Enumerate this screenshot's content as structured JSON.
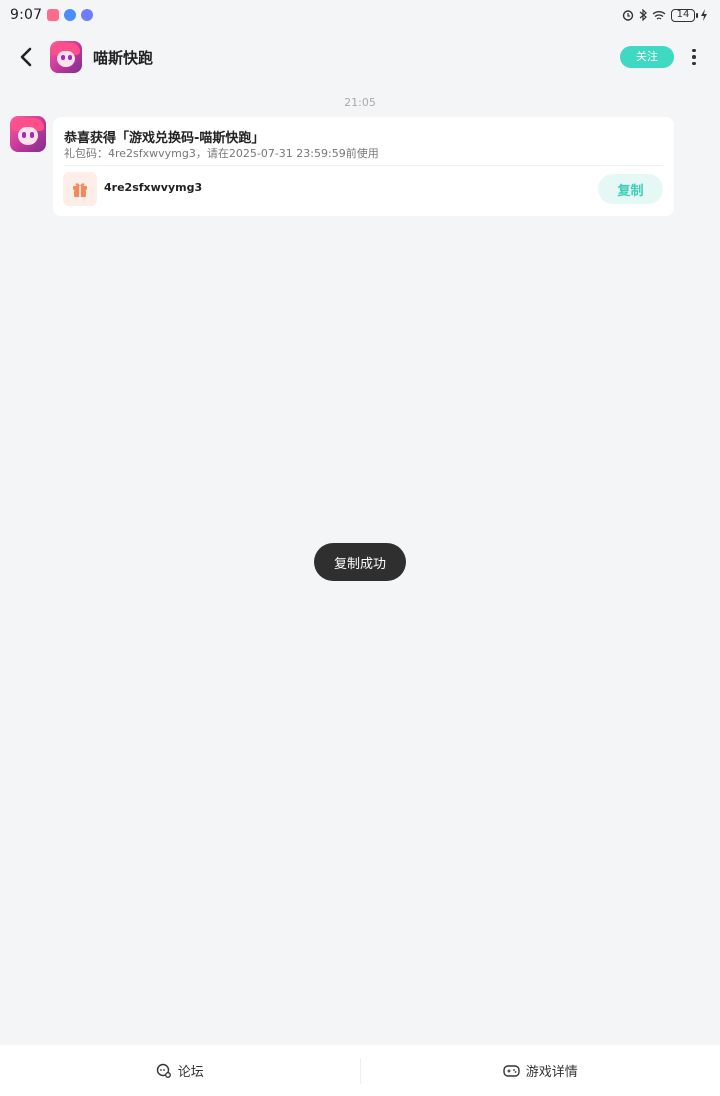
{
  "status_bar": {
    "time": "9:07",
    "battery": "14",
    "left_icons": [
      "app-notification-icon",
      "browser-icon",
      "music-icon"
    ],
    "right_icons": [
      "alarm-icon",
      "bluetooth-icon",
      "wifi-icon",
      "battery-icon",
      "charging-icon"
    ]
  },
  "header": {
    "app_name": "喵斯快跑",
    "follow_label": "关注",
    "back_icon": "chevron-left-icon",
    "more_icon": "more-vertical-icon"
  },
  "conversation": {
    "timestamp": "21:05",
    "message": {
      "title": "恭喜获得「游戏兑换码-喵斯快跑」",
      "subtitle": "礼包码：4re2sfxwvymg3，请在2025-07-31 23:59:59前使用",
      "code": "4re2sfxwvymg3",
      "copy_label": "复制",
      "gift_icon": "gift-icon"
    }
  },
  "toast": {
    "text": "复制成功"
  },
  "bottom_bar": {
    "tabs": [
      {
        "label": "论坛",
        "icon": "forum-icon"
      },
      {
        "label": "游戏详情",
        "icon": "gamepad-icon"
      }
    ]
  },
  "colors": {
    "accent": "#3fd8c2",
    "copy_text": "#3fcfb9",
    "copy_bg": "#e6f8f5",
    "gift_bg": "#fdeee8",
    "gift_icon": "#f08a5d",
    "background": "#f4f5f7",
    "toast_bg": "#2f2f2f"
  }
}
